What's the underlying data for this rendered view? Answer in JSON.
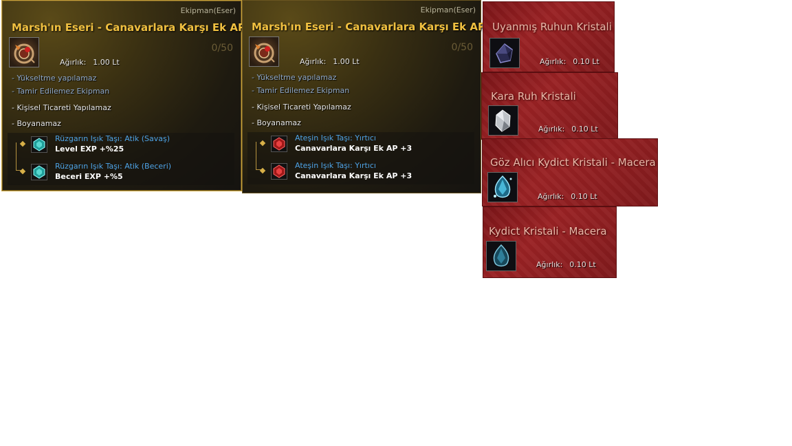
{
  "tooltips": [
    {
      "type": "Ekipman(Eser)",
      "title": "Marsh'ın Eseri - Canavarlara Karşı Ek AP",
      "enhance": "0/50",
      "icon": "marsh-relic-icon",
      "weight_label": "Ağırlık:",
      "weight_value": "1.00 Lt",
      "lines": [
        "- Yükseltme yapılamaz",
        "- Tamir Edilemez Ekipman",
        "- Kişisel Ticareti Yapılamaz",
        "- Boyanamaz"
      ],
      "sockets": [
        {
          "name": "Rüzgarın Işık Taşı: Atik (Savaş)",
          "effect": "Level EXP +%25",
          "gem": "wind-gem-icon"
        },
        {
          "name": "Rüzgarın Işık Taşı: Atik (Beceri)",
          "effect": "Beceri EXP +%5",
          "gem": "wind-gem-icon"
        }
      ]
    },
    {
      "type": "Ekipman(Eser)",
      "title": "Marsh'ın Eseri - Canavarlara Karşı Ek AP",
      "enhance": "0/50",
      "icon": "marsh-relic-icon",
      "weight_label": "Ağırlık:",
      "weight_value": "1.00 Lt",
      "lines": [
        "- Yükseltme yapılamaz",
        "- Tamir Edilemez Ekipman",
        "- Kişisel Ticareti Yapılamaz",
        "- Boyanamaz"
      ],
      "sockets": [
        {
          "name": "Ateşin Işık Taşı: Yırtıcı",
          "effect": "Canavarlara Karşı Ek AP +3",
          "gem": "fire-gem-icon"
        },
        {
          "name": "Ateşin Işık Taşı: Yırtıcı",
          "effect": "Canavarlara Karşı Ek AP +3",
          "gem": "fire-gem-icon"
        }
      ]
    }
  ],
  "crystals": [
    {
      "title": "Uyanmış Ruhun Kristali",
      "weight_label": "Ağırlık:",
      "weight_value": "0.10 Lt",
      "icon": "awakened-soul-crystal-icon"
    },
    {
      "title": "Kara Ruh Kristali",
      "weight_label": "Ağırlık:",
      "weight_value": "0.10 Lt",
      "icon": "black-soul-crystal-icon"
    },
    {
      "title": "Göz Alıcı Kydict Kristali - Macera",
      "weight_label": "Ağırlık:",
      "weight_value": "0.10 Lt",
      "icon": "dazzling-kydict-crystal-icon"
    },
    {
      "title": "Kydict Kristali - Macera",
      "weight_label": "Ağırlık:",
      "weight_value": "0.10 Lt",
      "icon": "kydict-crystal-icon"
    }
  ]
}
